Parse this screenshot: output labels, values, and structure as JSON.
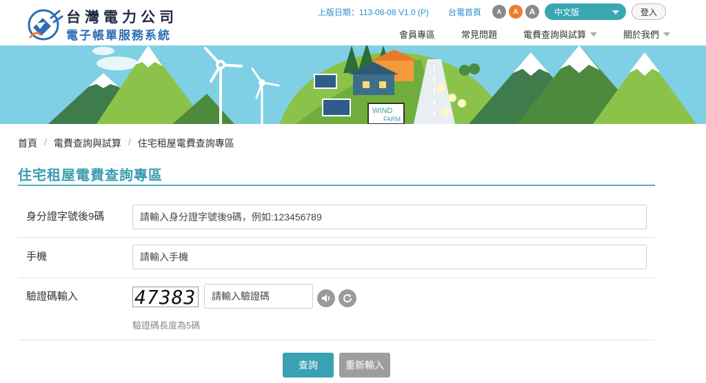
{
  "header": {
    "logo_title": "台灣電力公司",
    "logo_subtitle": "電子帳單服務系統",
    "version_text": "上版日期：113-08-08 V1.0 (P)",
    "home_link": "台電首頁",
    "font_sizes": [
      "A",
      "A",
      "A"
    ],
    "language": "中文版",
    "login": "登入",
    "nav": [
      {
        "label": "會員專區",
        "dropdown": false
      },
      {
        "label": "常見問題",
        "dropdown": false
      },
      {
        "label": "電費查詢與試算",
        "dropdown": true
      },
      {
        "label": "關於我們",
        "dropdown": true
      }
    ]
  },
  "banner": {
    "sign_line1": "WIND",
    "sign_line2": "FARM"
  },
  "breadcrumb": [
    "首頁",
    "電費查詢與試算",
    "住宅租屋電費查詢專區"
  ],
  "page_title": "住宅租屋電費查詢專區",
  "form": {
    "id_label": "身分證字號後9碼",
    "id_placeholder": "請輸入身分證字號後9碼，例如:123456789",
    "phone_label": "手機",
    "phone_placeholder": "請輸入手機",
    "captcha_label": "驗證碼輸入",
    "captcha_image_text": "47383",
    "captcha_placeholder": "請輸入驗證碼",
    "captcha_hint": "驗證碼長度為5碼"
  },
  "actions": {
    "submit": "查詢",
    "reset": "重新輸入"
  },
  "colors": {
    "accent": "#3aa0b4",
    "font_mid": "#f07c2c",
    "link": "#2c8fd0",
    "sky": "#7fd0e4",
    "grass": "#8bc34a"
  }
}
